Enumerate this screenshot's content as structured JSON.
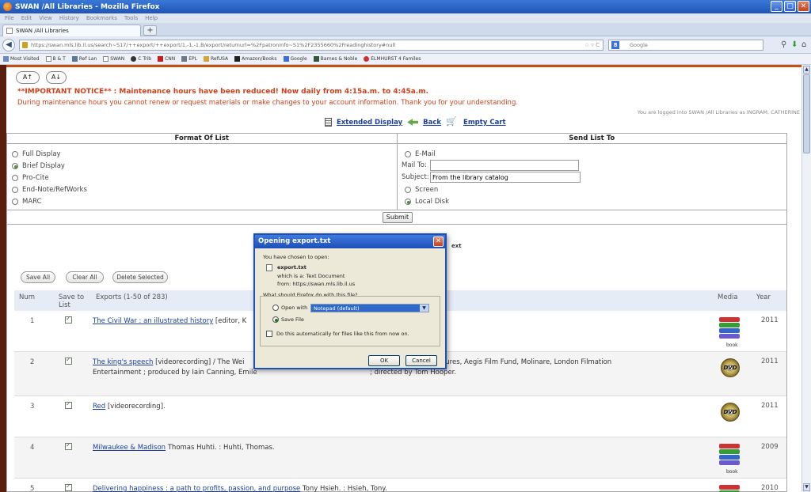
{
  "window": {
    "title": "SWAN /All Libraries - Mozilla Firefox"
  },
  "menu": [
    "File",
    "Edit",
    "View",
    "History",
    "Bookmarks",
    "Tools",
    "Help"
  ],
  "tab": {
    "label": "SWAN /All Libraries",
    "new_tab": "+"
  },
  "nav": {
    "url": "https://swan.mls.lib.il.us/search~S17/++export/++export/1,-1,-1,B/export/returnurl=%2Fpatroninfo~S1%2F2355660%2Freadinghistory#null",
    "search_engine": "Google",
    "search_placeholder": "Google"
  },
  "bookmarks": [
    "Most Visited",
    "B & T",
    "Ref Lan",
    "SWAN",
    "C Trib",
    "CNN",
    "EPL",
    "RefUSA",
    "Amazon/Books",
    "Google",
    "Barnes & Noble",
    "ELMHURST 4 Familes"
  ],
  "page": {
    "font_up": "A↑",
    "font_down": "A↓",
    "notice_title": "**IMPORTANT NOTICE** : Maintenance hours have been reduced! Now daily from 4:15a.m. to 4:45a.m.",
    "notice_body": "During maintenance hours you cannot renew or request materials or make changes to your account information. Thank you for your understanding.",
    "logged_in": "You are logged into SWAN /All Libraries as INGRAM, CATHERINE",
    "actions": {
      "extended": "Extended Display",
      "back": "Back",
      "empty_cart": "Empty Cart"
    },
    "format_head": "Format Of List",
    "send_head": "Send List To",
    "formats": [
      "Full Display",
      "Brief Display",
      "Pro-Cite",
      "End-Note/RefWorks",
      "MARC"
    ],
    "send": {
      "email": "E-Mail",
      "mail_to_label": "Mail To:",
      "mail_to_value": "",
      "subject_label": "Subject:",
      "subject_value": "From the library catalog",
      "screen": "Screen",
      "local_disk": "Local Disk"
    },
    "submit": "Submit",
    "behind_next": "ext",
    "buttons": {
      "save_all": "Save All",
      "clear_all": "Clear All",
      "delete_selected": "Delete Selected"
    },
    "table_head": {
      "num": "Num",
      "save_to": "Save to",
      "list": "List",
      "exports": "Exports (1-50 of 283)",
      "media": "Media",
      "year": "Year"
    },
    "rows": [
      {
        "num": "1",
        "title": "The Civil War : an illustrated history",
        "rest": " [editor, K",
        "media": "book",
        "year": "2011"
      },
      {
        "num": "2",
        "title": "The king's speech",
        "rest": " [videorecording] / The Wei",
        "rest2": "n with Momentum Pictures, Aegis Film Fund, Molinare, London Filmation",
        "line2a": "Entertainment ; produced by Iain Canning, Emile",
        "line2b": "; directed by Tom Hooper.",
        "media": "dvd",
        "year": "2011"
      },
      {
        "num": "3",
        "title": "Red",
        "rest": " [videorecording].",
        "media": "dvd",
        "year": "2011"
      },
      {
        "num": "4",
        "title": "Milwaukee & Madison",
        "rest": " Thomas Huhti. : Huhti, Thomas.",
        "media": "book",
        "year": "2009"
      },
      {
        "num": "5",
        "title": "Delivering happiness : a path to profits, passion, and purpose",
        "rest": " Tony Hsieh. : Hsieh, Tony.",
        "media": "book",
        "year": "2010"
      }
    ],
    "media_book_label": "book",
    "media_dvd_label": "DVD"
  },
  "dialog": {
    "title": "Opening export.txt",
    "chosen": "You have chosen to open:",
    "filename": "export.txt",
    "which_is": "which is a:  Text Document",
    "from": "from:  https://swan.mls.lib.il.us",
    "question": "What should Firefox do with this file?",
    "open_with": "Open with",
    "open_with_app": "Notepad (default)",
    "save_file": "Save File",
    "auto": "Do this automatically for files like this from now on.",
    "ok": "OK",
    "cancel": "Cancel"
  }
}
